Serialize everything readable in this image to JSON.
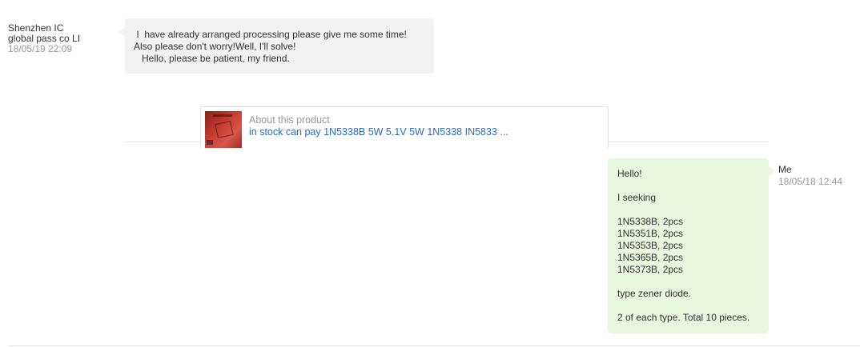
{
  "incoming": {
    "sender_line1": "Shenzhen IC",
    "sender_line2": "global pass co LI",
    "timestamp": "18/05/19 22:09",
    "lines": [
      " I  have already arranged processing please give me some time!",
      "Also please don't worry!Well, I'll solve!",
      "   Hello, please be patient, my friend."
    ]
  },
  "product": {
    "label": "About this product",
    "link_text": "in stock can pay 1N5338B 5W 5.1V 5W 1N5338 IN5833 ...",
    "thumbnail_icon": "product-thumbnail-image"
  },
  "outgoing": {
    "sender": "Me",
    "timestamp": "18/05/18 12:44",
    "greeting": "Hello!",
    "intro": "I seeking",
    "items": [
      "1N5338B, 2pcs",
      "1N5351B, 2pcs",
      "1N5353B, 2pcs",
      "1N5365B, 2pcs",
      "1N5373B, 2pcs"
    ],
    "type_line": "type zener diode.",
    "total_line": "2 of each type. Total 10 pieces."
  },
  "colors": {
    "incoming_bubble": "#f2f2f2",
    "outgoing_bubble": "#e9f8dd",
    "link": "#2a6bc8",
    "timestamp": "#999999"
  }
}
